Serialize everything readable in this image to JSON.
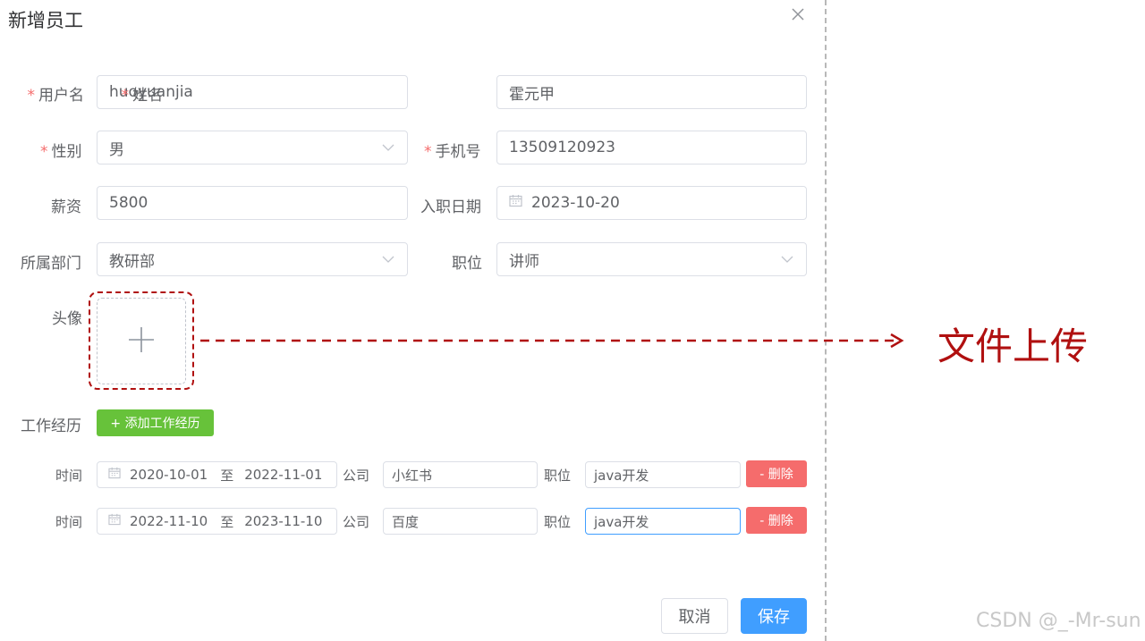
{
  "dialog": {
    "title": "新增员工",
    "close_icon": "close-icon",
    "fields": {
      "username": {
        "label": "用户名",
        "value": "huoyuanjia",
        "required": true
      },
      "name": {
        "label": "姓名",
        "value": "霍元甲",
        "required": true
      },
      "gender": {
        "label": "性别",
        "value": "男",
        "required": true
      },
      "phone": {
        "label": "手机号",
        "value": "13509120923",
        "required": true
      },
      "salary": {
        "label": "薪资",
        "value": "5800"
      },
      "entry_date": {
        "label": "入职日期",
        "value": "2023-10-20"
      },
      "department": {
        "label": "所属部门",
        "value": "教研部"
      },
      "position": {
        "label": "职位",
        "value": "讲师"
      },
      "avatar": {
        "label": "头像"
      }
    },
    "work_history": {
      "label": "工作经历",
      "add_button": "+ 添加工作经历",
      "time_label": "时间",
      "range_sep": "至",
      "company_label": "公司",
      "position_label": "职位",
      "delete_button": "- 删除",
      "rows": [
        {
          "start": "2020-10-01",
          "end": "2022-11-01",
          "company": "小红书",
          "position": "java开发"
        },
        {
          "start": "2022-11-10",
          "end": "2023-11-10",
          "company": "百度",
          "position": "java开发"
        }
      ]
    },
    "footer": {
      "cancel": "取消",
      "save": "保存"
    }
  },
  "annotation": {
    "text": "文件上传"
  },
  "watermark": "CSDN @_-Mr-sun",
  "colors": {
    "required": "#f56c6c",
    "primary": "#409eff",
    "success": "#67c23a",
    "danger": "#f56c6c",
    "annotation": "#b01010"
  }
}
